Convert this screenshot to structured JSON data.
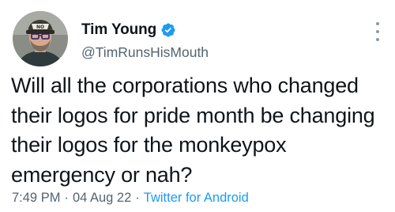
{
  "author": {
    "display_name": "Tim Young",
    "handle": "@TimRunsHisMouth",
    "verified": true
  },
  "tweet": {
    "text": "Will all the corporations who changed their logos for pride month be changing their logos for the monkeypox emergency or nah?",
    "time": "7:49 PM",
    "separator": "·",
    "date": "04 Aug 22",
    "source": "Twitter for Android"
  },
  "icons": {
    "avatar": "user-avatar",
    "verified": "verified-badge-icon",
    "more": "more-options-icon"
  },
  "colors": {
    "text": "#0f1419",
    "secondary": "#536471",
    "accent": "#1d9bf0"
  }
}
